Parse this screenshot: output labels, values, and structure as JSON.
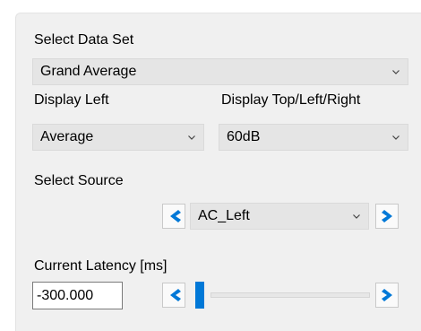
{
  "data_set": {
    "label": "Select Data Set",
    "selected": "Grand Average"
  },
  "display_left": {
    "label": "Display Left",
    "selected": "Average"
  },
  "display_tlr": {
    "label": "Display Top/Left/Right",
    "selected": "60dB"
  },
  "source": {
    "label": "Select Source",
    "selected": "AC_Left"
  },
  "latency": {
    "label": "Current Latency [ms]",
    "value": "-300.000",
    "slider_fraction": 0.0
  },
  "colors": {
    "accent": "#0078d7",
    "panel": "#f0f0f0",
    "combo": "#e5e5e5"
  },
  "icons": {
    "combo_arrow": "chevron-down-icon",
    "prev": "chevron-left-icon",
    "next": "chevron-right-icon"
  }
}
